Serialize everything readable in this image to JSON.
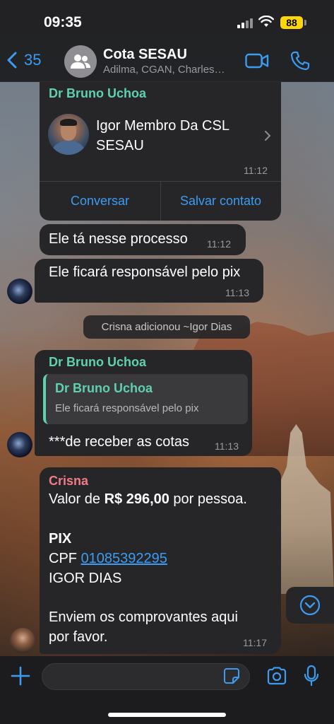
{
  "status": {
    "time": "09:35",
    "battery": "88"
  },
  "header": {
    "back_count": "35",
    "title": "Cota SESAU",
    "subtitle": "Adilma, CGAN, Charles…",
    "accent": "#3b9cf2"
  },
  "messages": {
    "contact_card": {
      "sender": "Dr Bruno Uchoa",
      "contact_name": "Igor Membro Da CSL SESAU",
      "time": "11:12",
      "btn_chat": "Conversar",
      "btn_save": "Salvar contato"
    },
    "m2": {
      "text": "Ele tá nesse processo",
      "time": "11:12"
    },
    "m3": {
      "text": "Ele ficará responsável pelo pix",
      "time": "11:13"
    },
    "system": {
      "text": "Crisna adicionou ~Igor Dias"
    },
    "m4": {
      "sender": "Dr Bruno Uchoa",
      "quote_name": "Dr Bruno Uchoa",
      "quote_text": "Ele ficará responsável pelo pix",
      "text": "***de receber as cotas",
      "time": "11:13"
    },
    "m5": {
      "sender": "Crisna",
      "line1_pre": "Valor de ",
      "line1_bold": "R$ 296,00",
      "line1_post": " por pessoa.",
      "line2": "PIX",
      "line3_pre": "CPF ",
      "line3_link": "01085392295",
      "line4": "IGOR DIAS",
      "line5": "Enviem os comprovantes aqui",
      "line6": "por favor.",
      "time": "11:17"
    }
  },
  "input": {
    "placeholder": ""
  }
}
